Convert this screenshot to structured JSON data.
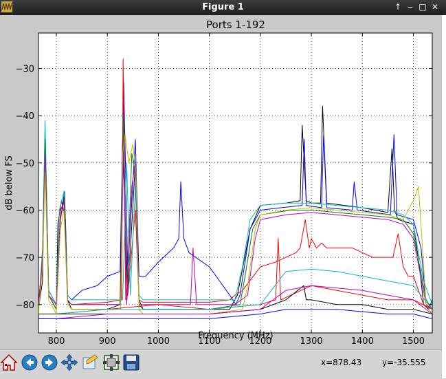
{
  "window": {
    "title": "Figure 1",
    "buttons": [
      "↑",
      "‒",
      "□",
      "✕"
    ]
  },
  "toolbar": {
    "buttons": [
      {
        "name": "home-icon"
      },
      {
        "name": "back-icon"
      },
      {
        "name": "forward-icon"
      },
      {
        "name": "pan-icon"
      },
      {
        "name": "zoom-icon"
      },
      {
        "name": "configure-subplots-icon"
      },
      {
        "name": "save-icon"
      }
    ],
    "x_readout": "x=878.43",
    "y_readout": "y=-35.555"
  },
  "chart_data": {
    "type": "line",
    "title": "Ports 1-192",
    "xlabel": "Frequency (MHz)",
    "ylabel": "dB below FS",
    "xlim": [
      765,
      1537
    ],
    "ylim": [
      -86,
      -22.5
    ],
    "xticks": [
      800,
      900,
      1000,
      1100,
      1200,
      1300,
      1400,
      1500
    ],
    "yticks": [
      -30,
      -40,
      -50,
      -60,
      -70,
      -80
    ],
    "grid": true,
    "legend": "none",
    "colors": [
      "#0000ff",
      "#008000",
      "#ff0000",
      "#00bfbf",
      "#bf00bf",
      "#bfbf00",
      "#000000"
    ],
    "series": [
      {
        "color": "#000000",
        "x": [
          765,
          773,
          778,
          785,
          800,
          803,
          810,
          818,
          822,
          830,
          900,
          925,
          930,
          940,
          955,
          962,
          970,
          1050,
          1100,
          1140,
          1155,
          1180,
          1200,
          1250,
          1278,
          1282,
          1290,
          1300,
          1318,
          1322,
          1330,
          1400,
          1450,
          1458,
          1463,
          1470,
          1500,
          1512,
          1520,
          1530,
          1537
        ],
        "y": [
          -81,
          -75,
          -44,
          -78,
          -81,
          -63,
          -58,
          -62,
          -79,
          -81,
          -81,
          -80,
          -45,
          -78,
          -50,
          -79,
          -81,
          -81,
          -81,
          -81,
          -78,
          -64,
          -59,
          -58.5,
          -58,
          -42,
          -58,
          -58.5,
          -58.5,
          -38,
          -58.5,
          -59.5,
          -60.5,
          -47,
          -60,
          -62,
          -63,
          -72,
          -80,
          -81,
          -79
        ]
      },
      {
        "color": "#0000ff",
        "x": [
          765,
          773,
          778,
          785,
          800,
          808,
          816,
          822,
          830,
          850,
          880,
          900,
          925,
          932,
          940,
          955,
          962,
          975,
          1000,
          1030,
          1040,
          1044,
          1050,
          1060,
          1100,
          1120,
          1140,
          1152,
          1160,
          1180,
          1200,
          1240,
          1282,
          1286,
          1290,
          1320,
          1324,
          1330,
          1380,
          1384,
          1390,
          1455,
          1462,
          1468,
          1500,
          1515,
          1525,
          1537
        ],
        "y": [
          -81,
          -72,
          -42,
          -77,
          -80,
          -62,
          -56,
          -78,
          -79,
          -77,
          -76,
          -74,
          -73,
          -33,
          -73,
          -45,
          -74,
          -74,
          -71,
          -68,
          -66,
          -54,
          -66,
          -69,
          -72,
          -75,
          -78,
          -80,
          -78,
          -64,
          -60,
          -59.5,
          -59,
          -45,
          -59,
          -59.5,
          -44,
          -59.5,
          -60,
          -54,
          -60,
          -61,
          -44,
          -61,
          -62,
          -68,
          -80,
          -81
        ]
      },
      {
        "color": "#ff0000",
        "x": [
          765,
          773,
          778,
          785,
          800,
          808,
          816,
          822,
          830,
          900,
          928,
          931,
          936,
          940,
          955,
          962,
          970,
          1100,
          1140,
          1150,
          1165,
          1200,
          1230,
          1250,
          1270,
          1278,
          1288,
          1296,
          1300,
          1310,
          1320,
          1330,
          1360,
          1380,
          1400,
          1420,
          1440,
          1460,
          1470,
          1480,
          1490,
          1500,
          1520,
          1537
        ],
        "y": [
          -80,
          -70,
          -46,
          -78,
          -80,
          -60,
          -58,
          -79,
          -80,
          -79.5,
          -79,
          -28,
          -79,
          -78,
          -60,
          -79,
          -79.5,
          -79.5,
          -79,
          -78,
          -77,
          -72,
          -71,
          -70,
          -69,
          -68,
          -62,
          -68,
          -66,
          -68,
          -67,
          -68,
          -68,
          -68,
          -69,
          -70,
          -70,
          -70,
          -65,
          -72,
          -74,
          -74,
          -80,
          -81
        ]
      },
      {
        "color": "#00bfbf",
        "x": [
          765,
          773,
          778,
          785,
          800,
          806,
          815,
          822,
          830,
          900,
          930,
          938,
          945,
          955,
          962,
          970,
          1100,
          1150,
          1165,
          1180,
          1200,
          1250,
          1300,
          1350,
          1400,
          1450,
          1480,
          1500,
          1520,
          1537
        ],
        "y": [
          -81,
          -68,
          -41,
          -77,
          -80,
          -60,
          -56,
          -78,
          -79,
          -79,
          -79,
          -50,
          -78,
          -55,
          -78,
          -79,
          -79,
          -79,
          -72,
          -62,
          -59,
          -58.5,
          -58.5,
          -59,
          -59.5,
          -60,
          -61,
          -63,
          -75,
          -80
        ]
      },
      {
        "color": "#008000",
        "x": [
          765,
          773,
          778,
          785,
          800,
          808,
          816,
          822,
          830,
          900,
          926,
          932,
          938,
          948,
          955,
          962,
          970,
          1100,
          1160,
          1170,
          1185,
          1200,
          1260,
          1300,
          1350,
          1400,
          1450,
          1480,
          1500,
          1525,
          1537
        ],
        "y": [
          -82,
          -70,
          -45,
          -78,
          -81,
          -62,
          -57,
          -79,
          -80,
          -80,
          -80,
          -40,
          -80,
          -48,
          -52,
          -80,
          -81,
          -81,
          -80,
          -74,
          -64,
          -61,
          -60,
          -60,
          -60.5,
          -61,
          -61.5,
          -62,
          -65,
          -79,
          -81
        ]
      },
      {
        "color": "#bf00bf",
        "x": [
          765,
          773,
          778,
          785,
          800,
          808,
          815,
          822,
          830,
          900,
          926,
          932,
          938,
          948,
          955,
          962,
          970,
          1050,
          1063,
          1068,
          1075,
          1100,
          1150,
          1175,
          1190,
          1200,
          1250,
          1300,
          1350,
          1400,
          1450,
          1480,
          1500,
          1525,
          1537
        ],
        "y": [
          -80,
          -70,
          -48,
          -78,
          -80,
          -62,
          -58,
          -79,
          -80,
          -80,
          -80,
          -45,
          -80,
          -55,
          -50,
          -80,
          -80,
          -80,
          -80,
          -68,
          -80,
          -80,
          -80,
          -78,
          -66,
          -62,
          -61,
          -60.5,
          -61,
          -61.5,
          -62,
          -63,
          -66,
          -80,
          -81
        ]
      },
      {
        "color": "#bfbf00",
        "x": [
          765,
          773,
          778,
          785,
          800,
          808,
          815,
          822,
          830,
          900,
          926,
          930,
          935,
          942,
          950,
          956,
          962,
          970,
          1100,
          1165,
          1175,
          1190,
          1200,
          1250,
          1300,
          1350,
          1400,
          1450,
          1480,
          1500,
          1510,
          1525,
          1537
        ],
        "y": [
          -82,
          -72,
          -52,
          -79,
          -82,
          -64,
          -60,
          -80,
          -81,
          -81,
          -81,
          -48,
          -44,
          -50,
          -46,
          -52,
          -81,
          -82,
          -82,
          -81,
          -76,
          -64,
          -61,
          -60,
          -59.5,
          -60,
          -60.5,
          -61,
          -62,
          -58,
          -55,
          -80,
          -82
        ]
      },
      {
        "color": "#ff0000",
        "x": [
          765,
          800,
          900,
          1000,
          1100,
          1200,
          1230,
          1235,
          1240,
          1280,
          1300,
          1350,
          1400,
          1450,
          1500,
          1537
        ],
        "y": [
          -82,
          -82,
          -81,
          -80,
          -81,
          -80,
          -79,
          -66,
          -79,
          -77,
          -76,
          -77,
          -78,
          -79,
          -79,
          -81
        ]
      },
      {
        "color": "#00bfbf",
        "x": [
          765,
          800,
          900,
          1000,
          1100,
          1200,
          1250,
          1300,
          1350,
          1400,
          1450,
          1500,
          1537
        ],
        "y": [
          -82,
          -82,
          -81,
          -81,
          -81,
          -80,
          -73,
          -72.5,
          -73,
          -74,
          -75,
          -76,
          -81
        ]
      },
      {
        "color": "#000000",
        "x": [
          765,
          800,
          900,
          1000,
          1100,
          1200,
          1250,
          1285,
          1290,
          1300,
          1350,
          1400,
          1450,
          1500,
          1537
        ],
        "y": [
          -82,
          -82,
          -82,
          -82,
          -82,
          -81,
          -79,
          -76,
          -79,
          -79,
          -80,
          -80,
          -81,
          -81,
          -82
        ]
      },
      {
        "color": "#bf00bf",
        "x": [
          765,
          800,
          900,
          1000,
          1100,
          1200,
          1250,
          1300,
          1350,
          1400,
          1450,
          1500,
          1537
        ],
        "y": [
          -83,
          -83,
          -82,
          -82,
          -82,
          -81,
          -77,
          -76,
          -76.5,
          -77,
          -78,
          -79,
          -82
        ]
      },
      {
        "color": "#0000ff",
        "x": [
          765,
          800,
          900,
          1000,
          1100,
          1200,
          1250,
          1300,
          1350,
          1400,
          1450,
          1500,
          1537
        ],
        "y": [
          -83,
          -83,
          -83,
          -83,
          -83,
          -82,
          -81,
          -81,
          -81,
          -81.5,
          -82,
          -82,
          -83
        ]
      }
    ]
  }
}
